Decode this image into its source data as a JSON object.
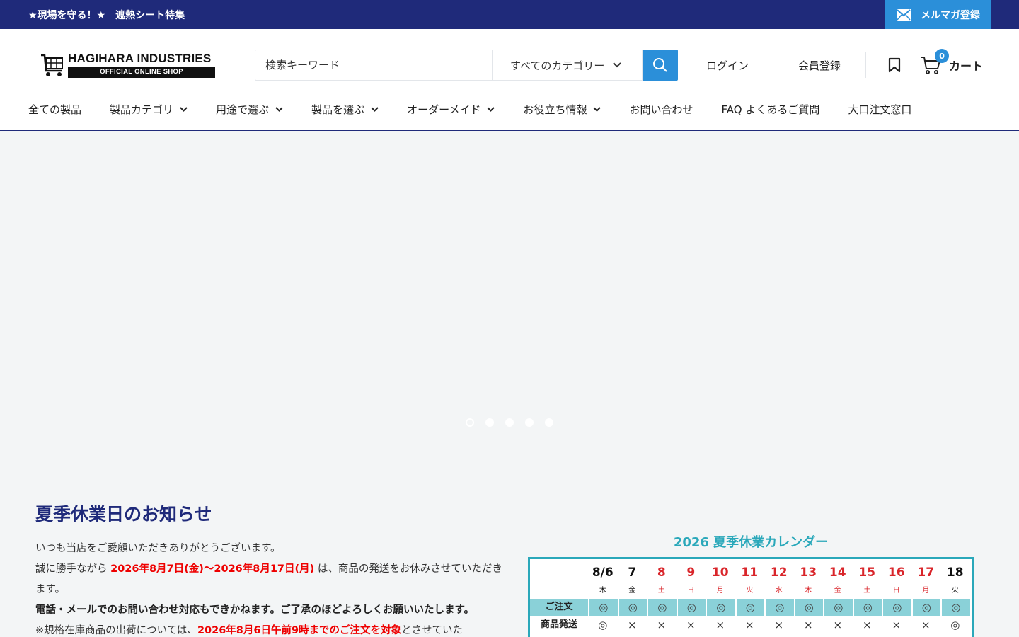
{
  "announcement": {
    "text": "★現場を守る！★　遮熱シート特集",
    "newsletter_label": "メルマガ登録"
  },
  "header": {
    "logo": {
      "brand": "HAGIHARA INDUSTRIES",
      "sub": "OFFICIAL ONLINE SHOP"
    },
    "search": {
      "placeholder": "検索キーワード",
      "category": "すべてのカテゴリー"
    },
    "login": "ログイン",
    "register": "会員登録",
    "cart": {
      "count": "0",
      "label": "カート"
    }
  },
  "nav": {
    "items": [
      {
        "label": "全ての製品",
        "dropdown": false
      },
      {
        "label": "製品カテゴリ",
        "dropdown": true
      },
      {
        "label": "用途で選ぶ",
        "dropdown": true
      },
      {
        "label": "製品を選ぶ",
        "dropdown": true
      },
      {
        "label": "オーダーメイド",
        "dropdown": true
      },
      {
        "label": "お役立ち情報",
        "dropdown": true
      },
      {
        "label": "お問い合わせ",
        "dropdown": false
      },
      {
        "label": "FAQ よくあるご質問",
        "dropdown": false
      },
      {
        "label": "大口注文窓口",
        "dropdown": false
      }
    ]
  },
  "slider": {
    "slide_count": 5,
    "active_index": 0
  },
  "notice": {
    "title": "夏季休業日のお知らせ",
    "line1": "いつも当店をご愛顧いただきありがとうございます。",
    "line2_pre": "誠に勝手ながら ",
    "line2_red": "2026年8月7日(金)～2026年8月17日(月)",
    "line2_post": " は、商品の発送をお休みさせていただきます。",
    "line3": "電話・メールでのお問い合わせ対応もできかねます。ご了承のほどよろしくお願いいたします。",
    "line4_pre": "※規格在庫商品の出荷については、",
    "line4_red": "2026年8月6日午前9時までのご注文を対象",
    "line4_post": "とさせていた"
  },
  "calendar": {
    "title": "2026 夏季休業カレンダー",
    "order_label": "ご注文",
    "ship_label": "商品発送",
    "days": [
      {
        "date": "8/6",
        "dow": "木",
        "order": "◎",
        "ship": "◎",
        "red": false
      },
      {
        "date": "7",
        "dow": "金",
        "order": "◎",
        "ship": "×",
        "red": false
      },
      {
        "date": "8",
        "dow": "土",
        "order": "◎",
        "ship": "×",
        "red": true
      },
      {
        "date": "9",
        "dow": "日",
        "order": "◎",
        "ship": "×",
        "red": true
      },
      {
        "date": "10",
        "dow": "月",
        "order": "◎",
        "ship": "×",
        "red": true
      },
      {
        "date": "11",
        "dow": "火",
        "order": "◎",
        "ship": "×",
        "red": true
      },
      {
        "date": "12",
        "dow": "水",
        "order": "◎",
        "ship": "×",
        "red": true
      },
      {
        "date": "13",
        "dow": "木",
        "order": "◎",
        "ship": "×",
        "red": true
      },
      {
        "date": "14",
        "dow": "金",
        "order": "◎",
        "ship": "×",
        "red": true
      },
      {
        "date": "15",
        "dow": "土",
        "order": "◎",
        "ship": "×",
        "red": true
      },
      {
        "date": "16",
        "dow": "日",
        "order": "◎",
        "ship": "×",
        "red": true
      },
      {
        "date": "17",
        "dow": "月",
        "order": "◎",
        "ship": "×",
        "red": true
      },
      {
        "date": "18",
        "dow": "火",
        "order": "◎",
        "ship": "◎",
        "red": false
      }
    ]
  },
  "colors": {
    "navy": "#1f2a7a",
    "accent": "#2b8fd9",
    "teal": "#2aa8ba",
    "red": "#e00000"
  }
}
